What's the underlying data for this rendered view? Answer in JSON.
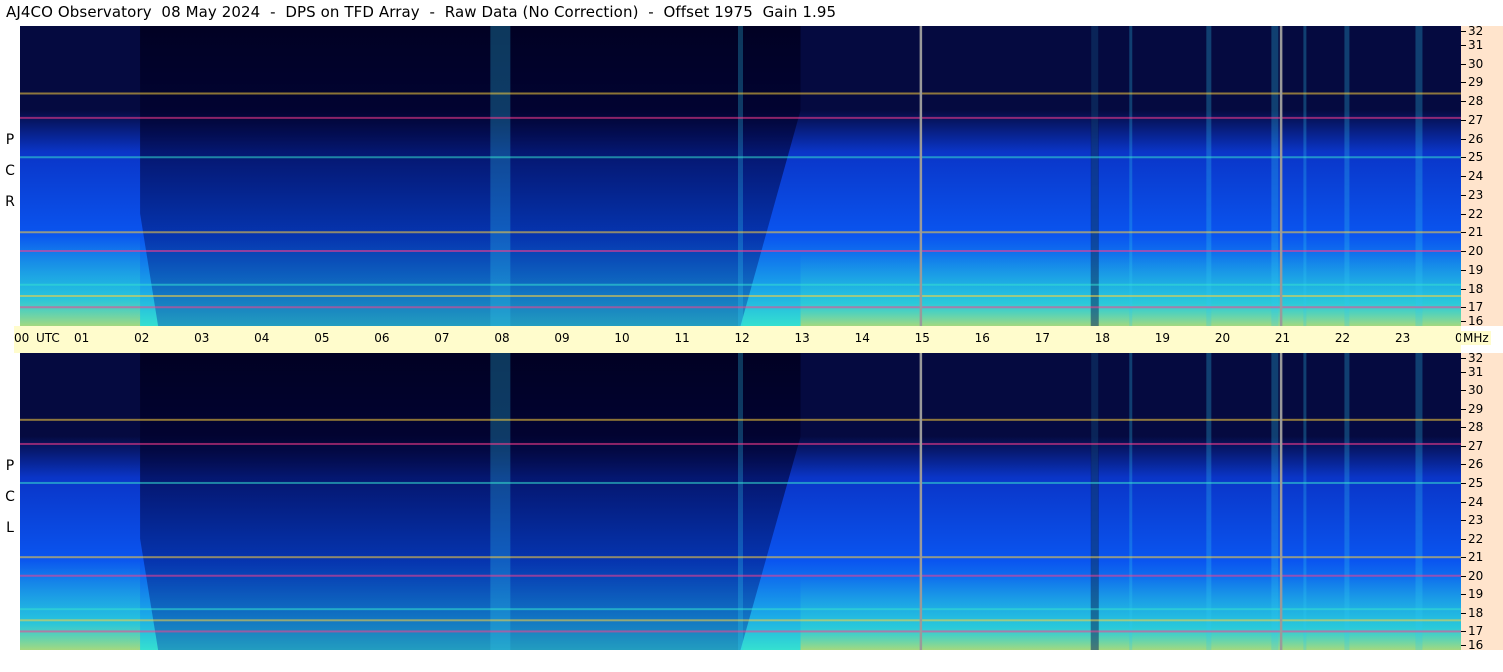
{
  "title": "AJ4CO Observatory  08 May 2024  -  DPS on TFD Array  -  Raw Data (No Correction)  -  Offset 1975  Gain 1.95",
  "panels": [
    {
      "label": "R C P",
      "letters": [
        "P",
        "C",
        "R"
      ]
    },
    {
      "label": "L C P",
      "letters": [
        "P",
        "C",
        "L"
      ]
    }
  ],
  "colors": {
    "background": "#ffffff",
    "time_axis_bg": "#fffccc",
    "freq_axis_bg": "#ffe4cc",
    "spectrogram_low": "#050a40",
    "spectrogram_mid": "#0a55f0",
    "spectrogram_high": "#35e0d0",
    "spectrogram_peak": "#ffd23c",
    "spectrogram_rfi": "#ff3c8c"
  },
  "chart_data": {
    "type": "heatmap",
    "title": "AJ4CO Observatory  08 May 2024  -  DPS on TFD Array  -  Raw Data (No Correction)  -  Offset 1975  Gain 1.95",
    "x_axis": {
      "unit": "UTC",
      "tick_labels": [
        "00",
        "01",
        "02",
        "03",
        "04",
        "05",
        "06",
        "07",
        "08",
        "09",
        "10",
        "11",
        "12",
        "13",
        "14",
        "15",
        "16",
        "17",
        "18",
        "19",
        "20",
        "21",
        "22",
        "23",
        "00"
      ],
      "range": [
        0,
        24
      ]
    },
    "y_axis": {
      "unit": "MHz",
      "tick_labels": [
        "16",
        "17",
        "18",
        "19",
        "20",
        "21",
        "22",
        "23",
        "24",
        "25",
        "26",
        "27",
        "28",
        "29",
        "30",
        "31",
        "32"
      ],
      "range": [
        16,
        32
      ]
    },
    "panels": [
      "R C P",
      "L C P"
    ],
    "band_edges_utc": [
      0,
      2.0,
      12.0,
      13.0,
      24.0
    ],
    "bright_rfi_frequencies_mhz": [
      17.0,
      17.6,
      18.2,
      20.0,
      21.0,
      25.0,
      27.1,
      28.4
    ],
    "marker_lines_utc": [
      15.0,
      21.0
    ],
    "vertical_bursts_utc": [
      8.0,
      12.0,
      17.9,
      18.5,
      19.8,
      20.9,
      21.4,
      22.1,
      23.3
    ]
  }
}
